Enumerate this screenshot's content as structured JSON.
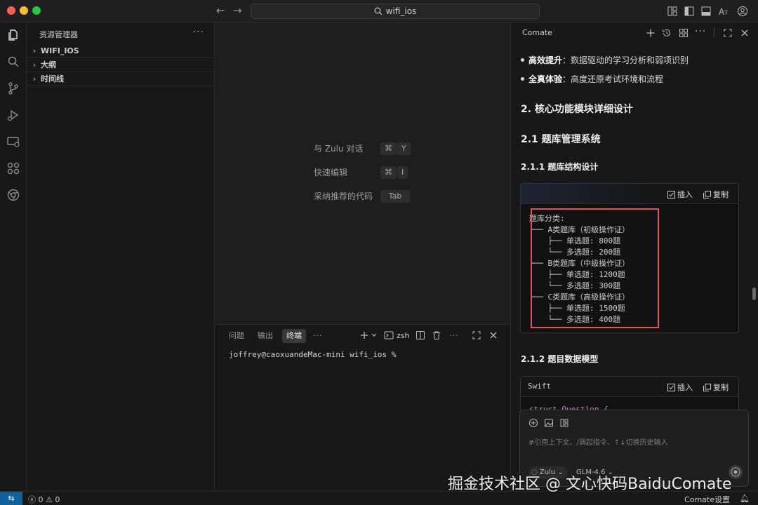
{
  "window": {
    "search_text": "wifi_ios",
    "traffic_colors": {
      "close": "#ff5f57",
      "minimize": "#febc2e",
      "maximize": "#28c840"
    }
  },
  "sidebar": {
    "header": "资源管理器",
    "more": "···",
    "sections": [
      {
        "label": "WIFI_IOS"
      },
      {
        "label": "大纲"
      },
      {
        "label": "时间线"
      }
    ]
  },
  "editor": {
    "hints": [
      {
        "label": "与 Zulu 对话",
        "keys": [
          "⌘",
          "Y"
        ]
      },
      {
        "label": "快速编辑",
        "keys": [
          "⌘",
          "I"
        ]
      },
      {
        "label": "采纳推荐的代码",
        "keys": [
          "Tab"
        ]
      }
    ]
  },
  "panel": {
    "tabs": [
      "问题",
      "输出",
      "终端"
    ],
    "active_tab": "终端",
    "more": "···",
    "shell": "zsh",
    "prompt": "joffrey@caoxuandeMac-mini wifi_ios %"
  },
  "chat": {
    "title": "Comate",
    "bullets": [
      {
        "bold": "高效提升",
        "text": "：数据驱动的学习分析和弱项识别"
      },
      {
        "bold": "全真体验",
        "text": "：高度还原考试环境和流程"
      }
    ],
    "h2_modules": "2. 核心功能模块详细设计",
    "h2_bank": "2.1 题库管理系统",
    "h3_structure": "2.1.1 题库结构设计",
    "h3_model": "2.1.2 题目数据模型",
    "insert_label": "插入",
    "copy_label": "复制",
    "code1_lines": [
      "题库分类:",
      "├── A类题库（初级操作证）",
      "│   ├── 单选题: 800题",
      "│   └── 多选题: 200题",
      "├── B类题库（中级操作证）",
      "│   ├── 单选题: 1200题",
      "│   └── 多选题: 300题",
      "└── C类题库（高级操作证）",
      "    ├── 单选题: 1500题",
      "    └── 多选题: 400题"
    ],
    "code2_lang": "Swift",
    "code2_first": "struct Question {",
    "input_placeholder": "#引用上下文、/调起指令、↑↓切换历史输入",
    "agent_label": "Zulu",
    "model_label": "GLM-4.6"
  },
  "statusbar": {
    "errors": "0",
    "warnings": "0",
    "settings_label": "Comate设置"
  },
  "watermark": "掘金技术社区 @ 文心快码BaiduComate",
  "colors": {
    "accent": "#0e639c",
    "highlight": "#e05757"
  }
}
